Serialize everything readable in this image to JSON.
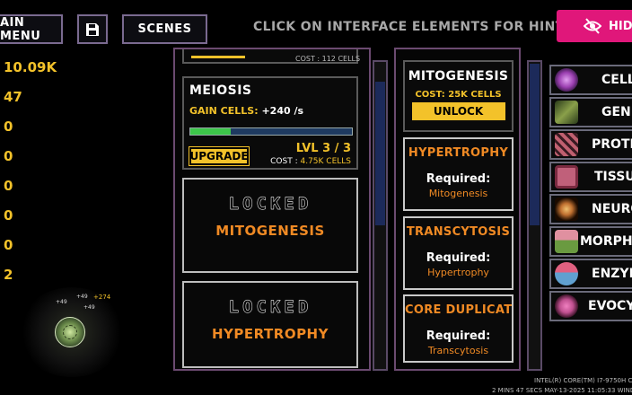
{
  "top": {
    "main_menu": "AIN MENU",
    "scenes": "SCENES",
    "hint": "CLICK ON INTERFACE ELEMENTS FOR HINTS",
    "hide": "HIDE"
  },
  "resources": [
    "10.09K",
    "47",
    "0",
    "0",
    "0",
    "0",
    "0",
    "2"
  ],
  "floaters": [
    "+49",
    "+49",
    "+274",
    "+49"
  ],
  "upgrades": {
    "top_partial": "COST : 112 CELLS",
    "meiosis": {
      "title": "MEIOSIS",
      "gain_label": "GAIN CELLS:",
      "gain_value": "+240 /s",
      "progress": 0.25,
      "upgrade_label": "UPGRADE",
      "level": "LVL 3 / 3",
      "cost_label": "COST :",
      "cost_value": "4.75K CELLS"
    },
    "locked": [
      {
        "title": "LOCKED",
        "name": "MITOGENESIS"
      },
      {
        "title": "LOCKED",
        "name": "HYPERTROPHY"
      }
    ]
  },
  "unlocks": {
    "featured": {
      "title": "MITOGENESIS",
      "cost": "COST: 25K CELLS",
      "button": "UNLOCK"
    },
    "items": [
      {
        "title": "HYPERTROPHY",
        "required": "Required:",
        "name": "Mitogenesis"
      },
      {
        "title": "TRANSCYTOSIS",
        "required": "Required:",
        "name": "Hypertrophy"
      },
      {
        "title": "CORE DUPLICATION",
        "required": "Required:",
        "name": "Transcytosis"
      }
    ]
  },
  "sidebar": [
    {
      "label": "CELL",
      "icon": "cell-icon",
      "color": "#9b3fb0"
    },
    {
      "label": "GENE",
      "icon": "dna-icon",
      "color": "#6f8a3a"
    },
    {
      "label": "PROTE",
      "icon": "protein-icon",
      "color": "#c06070"
    },
    {
      "label": "TISSU",
      "icon": "tissue-icon",
      "color": "#c0607a"
    },
    {
      "label": "NEURO",
      "icon": "neuron-icon",
      "color": "#d08a40"
    },
    {
      "label": "MORPHO",
      "icon": "morphology-icon",
      "color": "#8ab050"
    },
    {
      "label": "ENZYM",
      "icon": "enzyme-icon",
      "color": "#d06080"
    },
    {
      "label": "EVOCYT",
      "icon": "evocyte-icon",
      "color": "#c05090"
    }
  ],
  "footer": {
    "cpu": "INTEL(R) CORE(TM) I7-9750H CPU",
    "time": "2 MINS 47 SECS    MAY-13-2025 11:05:33    WINDO"
  }
}
